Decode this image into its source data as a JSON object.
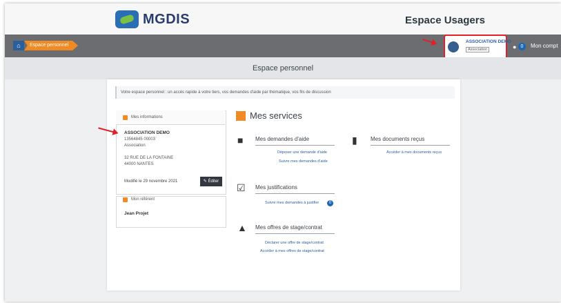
{
  "header": {
    "logo_text": "MGDIS",
    "espace_title": "Espace Usagers"
  },
  "nav": {
    "breadcrumb": "Espace personnel",
    "account": {
      "name": "ASSOCIATION DEMO",
      "type_tag": "Association",
      "notification_count": "0",
      "mon_compte": "Mon compt"
    }
  },
  "page": {
    "title": "Espace personnel",
    "intro": "Votre espace personnel : un accès rapide à votre tiers, vos demandes d'aide par thématique, vos fils de discussion"
  },
  "mes_informations": {
    "label": "Mes informations",
    "name": "ASSOCIATION DEMO",
    "siret": "13564845 00003",
    "type": "Association",
    "address1": "32 RUE DE LA FONTAINE",
    "address2": "44000 NANTES",
    "modified": "Modifié le 29 novembre 2021",
    "edit_label": "Éditer"
  },
  "referent": {
    "label": "Mon référent",
    "name": "Jean Projet"
  },
  "services": {
    "title": "Mes services",
    "demandes": {
      "title": "Mes demandes d'aide",
      "links": [
        "Déposer une demande d'aide",
        "Suivre mes demandes d'aide"
      ]
    },
    "documents": {
      "title": "Mes documents reçus",
      "links": [
        "Accéder à mes documents reçus"
      ]
    },
    "justifications": {
      "title": "Mes justifications",
      "links": [
        "Suivre mes demandes à justifier"
      ],
      "count": "0"
    },
    "offres": {
      "title": "Mes offres de stage/contrat",
      "links": [
        "Déclarer une offre de stage/contrat",
        "Accéder à mes offres de stage/contrat"
      ]
    }
  },
  "colors": {
    "accent": "#f08a24",
    "link": "#2a5f9e",
    "highlight": "#e2202a",
    "navbar": "#6b6d70"
  }
}
